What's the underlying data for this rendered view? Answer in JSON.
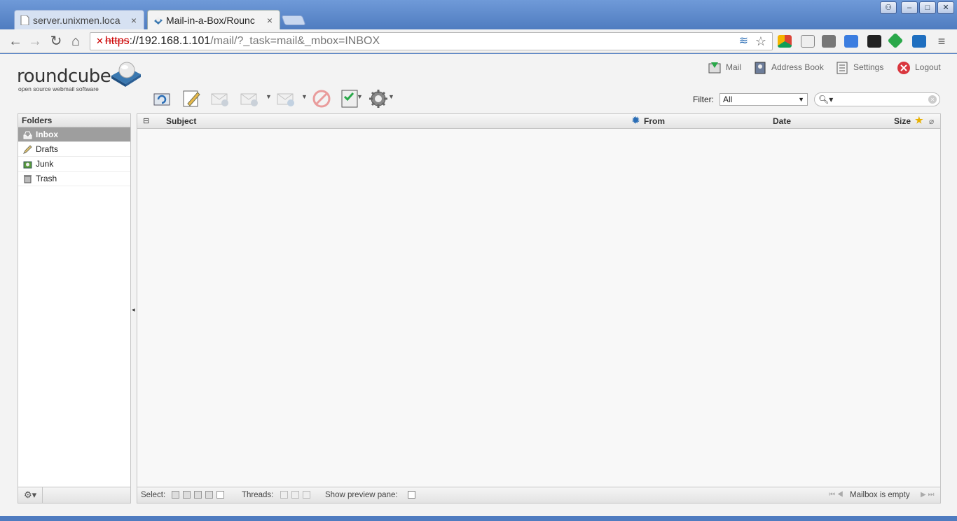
{
  "browser": {
    "tabs": [
      {
        "label": "server.unixmen.loca",
        "close": "×"
      },
      {
        "label": "Mail-in-a-Box/Rounc",
        "close": "×"
      }
    ],
    "window_buttons": [
      "⚇",
      "–",
      "□",
      "✕"
    ],
    "url": {
      "scheme": "https",
      "rest": "://192.168.1.101",
      "path": "/mail/?_task=mail&_mbox=INBOX"
    }
  },
  "app": {
    "logo": {
      "word": "roundcube",
      "tagline": "open source webmail software"
    },
    "topnav": [
      {
        "label": "Mail",
        "icon": "mail-icon"
      },
      {
        "label": "Address Book",
        "icon": "address-book-icon"
      },
      {
        "label": "Settings",
        "icon": "settings-icon"
      },
      {
        "label": "Logout",
        "icon": "logout-icon"
      }
    ],
    "filter": {
      "label": "Filter:",
      "value": "All"
    },
    "folders": {
      "title": "Folders",
      "items": [
        {
          "label": "Inbox",
          "selected": true
        },
        {
          "label": "Drafts",
          "selected": false
        },
        {
          "label": "Junk",
          "selected": false
        },
        {
          "label": "Trash",
          "selected": false
        }
      ]
    },
    "list": {
      "columns": {
        "subject": "Subject",
        "from": "From",
        "date": "Date",
        "size": "Size"
      }
    },
    "footer": {
      "select_label": "Select:",
      "threads_label": "Threads:",
      "preview_label": "Show preview pane:",
      "status": "Mailbox is empty"
    }
  },
  "colors": {
    "accent": "#4f7cc0",
    "selected_folder": "#9e9e9e",
    "logout": "#d9363e"
  }
}
